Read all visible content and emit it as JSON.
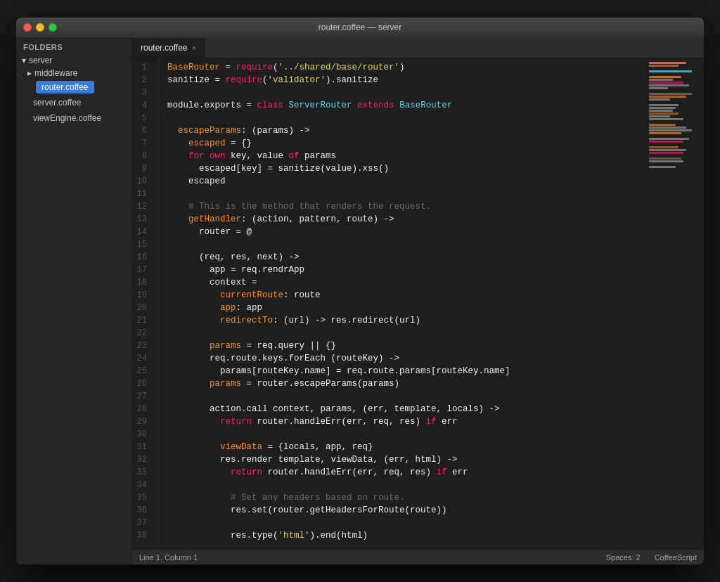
{
  "window": {
    "title": "router.coffee — server",
    "traffic_lights": [
      "close",
      "minimize",
      "maximize"
    ]
  },
  "titlebar": {
    "title": "router.coffee — server"
  },
  "sidebar": {
    "header": "FOLDERS",
    "items": [
      {
        "label": "server",
        "type": "folder-open",
        "indent": 0
      },
      {
        "label": "middleware",
        "type": "folder-closed",
        "indent": 1
      },
      {
        "label": "router.coffee",
        "type": "file",
        "indent": 1,
        "selected": true
      },
      {
        "label": "server.coffee",
        "type": "file",
        "indent": 1
      },
      {
        "label": "viewEngine.coffee",
        "type": "file",
        "indent": 1
      }
    ]
  },
  "tab": {
    "label": "router.coffee",
    "close_icon": "×"
  },
  "status_bar": {
    "position": "Line 1, Column 1",
    "spaces": "Spaces: 2",
    "language": "CoffeeScript"
  },
  "code": {
    "lines": [
      {
        "num": 1,
        "content": "BaseRouter = require('../shared/base/router')"
      },
      {
        "num": 2,
        "content": "sanitize = require('validator').sanitize"
      },
      {
        "num": 3,
        "content": ""
      },
      {
        "num": 4,
        "content": "module.exports = class ServerRouter extends BaseRouter"
      },
      {
        "num": 5,
        "content": ""
      },
      {
        "num": 6,
        "content": "  escapeParams: (params) ->"
      },
      {
        "num": 7,
        "content": "    escaped = {}"
      },
      {
        "num": 8,
        "content": "    for own key, value of params"
      },
      {
        "num": 9,
        "content": "      escaped[key] = sanitize(value).xss()"
      },
      {
        "num": 10,
        "content": "    escaped"
      },
      {
        "num": 11,
        "content": ""
      },
      {
        "num": 12,
        "content": "    # This is the method that renders the request."
      },
      {
        "num": 13,
        "content": "    getHandler: (action, pattern, route) ->"
      },
      {
        "num": 14,
        "content": "      router = @"
      },
      {
        "num": 15,
        "content": ""
      },
      {
        "num": 16,
        "content": "      (req, res, next) ->"
      },
      {
        "num": 17,
        "content": "        app = req.rendrApp"
      },
      {
        "num": 18,
        "content": "        context ="
      },
      {
        "num": 19,
        "content": "          currentRoute: route"
      },
      {
        "num": 20,
        "content": "          app: app"
      },
      {
        "num": 21,
        "content": "          redirectTo: (url) -> res.redirect(url)"
      },
      {
        "num": 22,
        "content": ""
      },
      {
        "num": 23,
        "content": "        params = req.query || {}"
      },
      {
        "num": 24,
        "content": "        req.route.keys.forEach (routeKey) ->"
      },
      {
        "num": 25,
        "content": "          params[routeKey.name] = req.route.params[routeKey.name]"
      },
      {
        "num": 26,
        "content": "        params = router.escapeParams(params)"
      },
      {
        "num": 27,
        "content": ""
      },
      {
        "num": 28,
        "content": "        action.call context, params, (err, template, locals) ->"
      },
      {
        "num": 29,
        "content": "          return router.handleErr(err, req, res) if err"
      },
      {
        "num": 30,
        "content": ""
      },
      {
        "num": 31,
        "content": "          viewData = {locals, app, req}"
      },
      {
        "num": 32,
        "content": "          res.render template, viewData, (err, html) ->"
      },
      {
        "num": 33,
        "content": "            return router.handleErr(err, req, res) if err"
      },
      {
        "num": 34,
        "content": ""
      },
      {
        "num": 35,
        "content": "            # Set any headers based on route."
      },
      {
        "num": 36,
        "content": "            res.set(router.getHeadersForRoute(route))"
      },
      {
        "num": 37,
        "content": ""
      },
      {
        "num": 38,
        "content": "            res.type('html').end(html)"
      }
    ]
  }
}
